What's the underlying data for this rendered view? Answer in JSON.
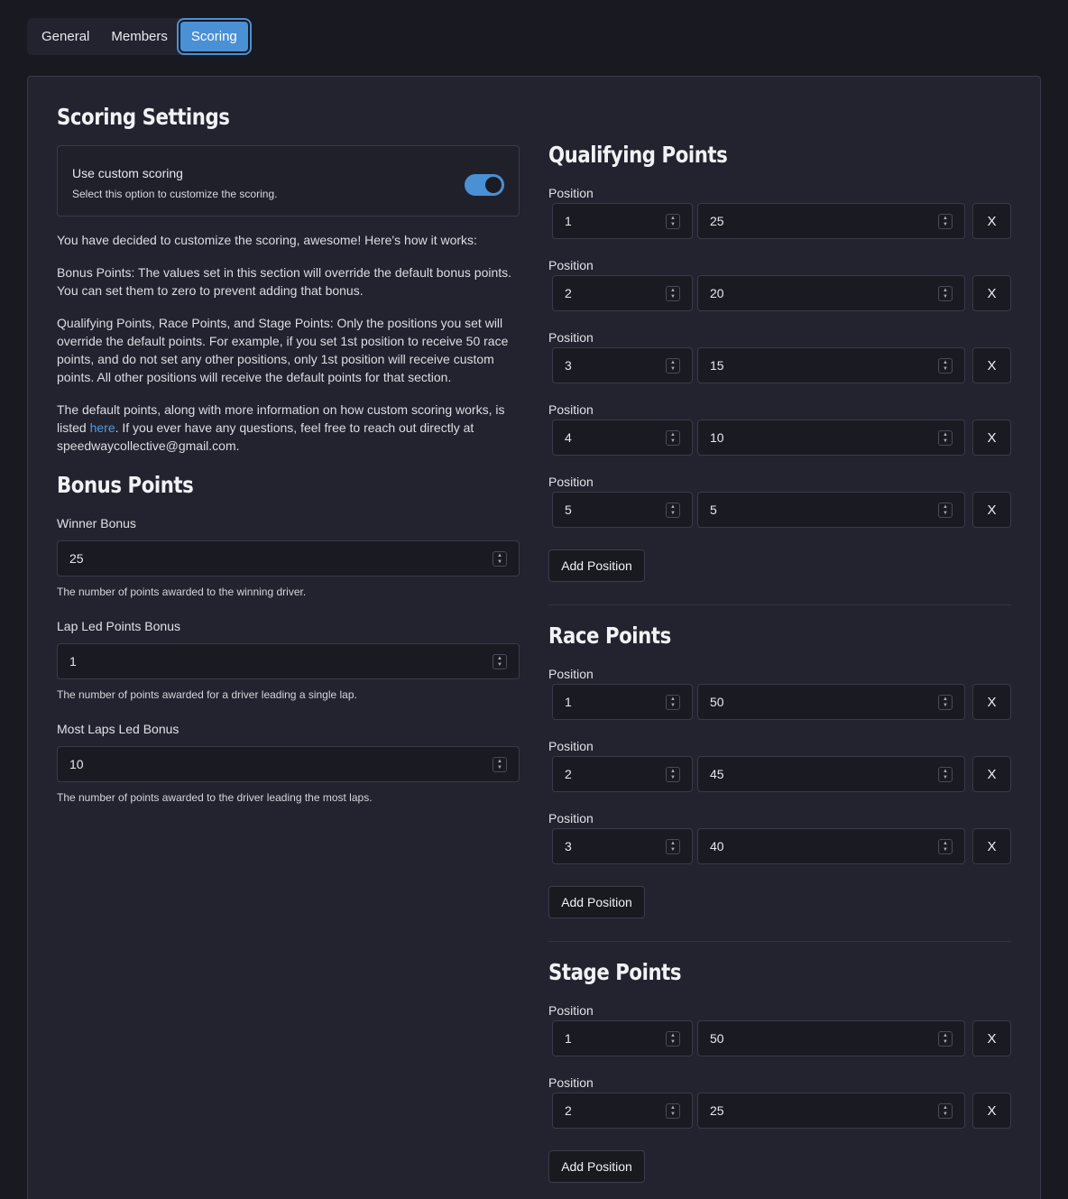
{
  "tabs": [
    {
      "label": "General",
      "active": false
    },
    {
      "label": "Members",
      "active": false
    },
    {
      "label": "Scoring",
      "active": true
    }
  ],
  "settings": {
    "title": "Scoring Settings",
    "custom_toggle": {
      "title": "Use custom scoring",
      "description": "Select this option to customize the scoring.",
      "enabled": true
    },
    "intro": "You have decided to customize the scoring, awesome! Here's how it works:",
    "bonus_info": "Bonus Points: The values set in this section will override the default bonus points. You can set them to zero to prevent adding that bonus.",
    "positions_info": "Qualifying Points, Race Points, and Stage Points: Only the positions you set will override the default points. For example, if you set 1st position to receive 50 race points, and do not set any other positions, only 1st position will receive custom points. All other positions will receive the default points for that section.",
    "default_info_prefix": "The default points, along with more information on how custom scoring works, is listed ",
    "default_info_link": "here",
    "default_info_suffix": ". If you ever have any questions, feel free to reach out directly at speedwaycollective@gmail.com."
  },
  "bonus": {
    "title": "Bonus Points",
    "winner": {
      "label": "Winner Bonus",
      "value": "25",
      "help": "The number of points awarded to the winning driver."
    },
    "lap_led": {
      "label": "Lap Led Points Bonus",
      "value": "1",
      "help": "The number of points awarded for a driver leading a single lap."
    },
    "most_laps": {
      "label": "Most Laps Led Bonus",
      "value": "10",
      "help": "The number of points awarded to the driver leading the most laps."
    }
  },
  "qualifying": {
    "title": "Qualifying Points",
    "rows": [
      {
        "label": "Position",
        "position": "1",
        "points": "25",
        "remove": "X"
      },
      {
        "label": "Position",
        "position": "2",
        "points": "20",
        "remove": "X"
      },
      {
        "label": "Position",
        "position": "3",
        "points": "15",
        "remove": "X"
      },
      {
        "label": "Position",
        "position": "4",
        "points": "10",
        "remove": "X"
      },
      {
        "label": "Position",
        "position": "5",
        "points": "5",
        "remove": "X"
      }
    ],
    "add_label": "Add Position"
  },
  "race": {
    "title": "Race Points",
    "rows": [
      {
        "label": "Position",
        "position": "1",
        "points": "50",
        "remove": "X"
      },
      {
        "label": "Position",
        "position": "2",
        "points": "45",
        "remove": "X"
      },
      {
        "label": "Position",
        "position": "3",
        "points": "40",
        "remove": "X"
      }
    ],
    "add_label": "Add Position"
  },
  "stage": {
    "title": "Stage Points",
    "rows": [
      {
        "label": "Position",
        "position": "1",
        "points": "50",
        "remove": "X"
      },
      {
        "label": "Position",
        "position": "2",
        "points": "25",
        "remove": "X"
      }
    ],
    "add_label": "Add Position"
  },
  "icons": {
    "spinner": "number-spinner-icon"
  },
  "colors": {
    "accent": "#4a90d4",
    "link": "#4d9be6",
    "background": "#191922",
    "card": "#23232f"
  }
}
